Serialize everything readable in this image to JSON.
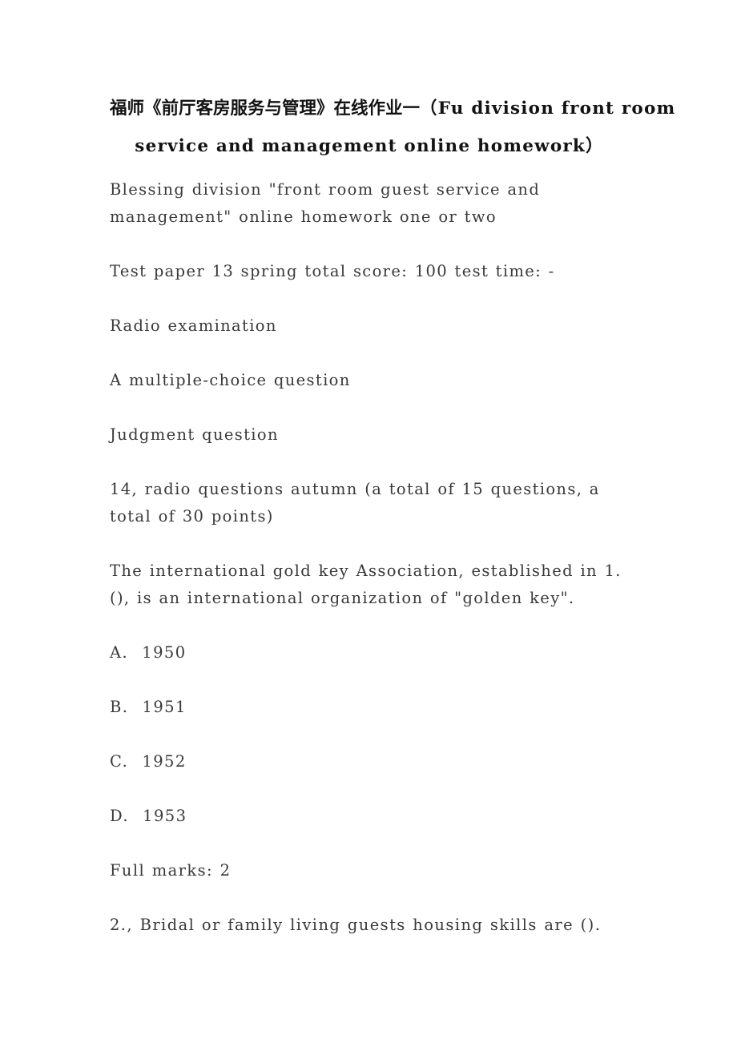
{
  "document": {
    "title": {
      "line1_cjk": "福师《前厅客房服务与管理》在线作业一",
      "line1_latin": "（Fu division front room",
      "line2": "service and management online homework）"
    },
    "paragraphs": [
      {
        "id": "intro",
        "text": "Blessing division \"front room guest service and management\" online homework one or two"
      },
      {
        "id": "test-info",
        "text": "Test paper 13 spring total score: 100 test time: -"
      },
      {
        "id": "section-radio",
        "text": "Radio examination"
      },
      {
        "id": "section-multiple-choice",
        "text": "A multiple-choice question"
      },
      {
        "id": "section-judgment",
        "text": "Judgment question"
      },
      {
        "id": "section-count",
        "text": "14, radio questions autumn (a total of 15 questions, a total of 30 points)"
      },
      {
        "id": "question-1",
        "text": "The international gold key Association, established in 1. (), is an international organization of \"golden key\"."
      }
    ],
    "options": [
      {
        "label": "A.",
        "value": "1950"
      },
      {
        "label": "B.",
        "value": "1951"
      },
      {
        "label": "C.",
        "value": "1952"
      },
      {
        "label": "D.",
        "value": "1953"
      }
    ],
    "full_marks": "Full marks: 2",
    "question_2": "2., Bridal or family living guests housing skills are ()."
  }
}
